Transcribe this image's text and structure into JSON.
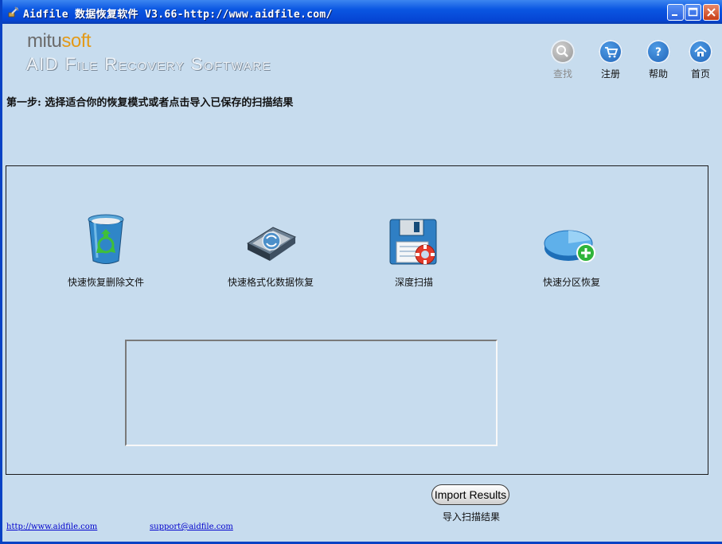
{
  "window": {
    "title": "Aidfile 数据恢复软件 V3.66-http://www.aidfile.com/",
    "buttons": [
      "minimize",
      "maximize",
      "close"
    ]
  },
  "logo": {
    "brand_prefix": "mitu",
    "brand_suffix": "soft",
    "subtitle": "AID File Recovery Software"
  },
  "topnav": [
    {
      "label": "查找",
      "icon": "magnifier-icon",
      "enabled": false
    },
    {
      "label": "注册",
      "icon": "cart-icon",
      "enabled": true
    },
    {
      "label": "帮助",
      "icon": "question-icon",
      "enabled": true
    },
    {
      "label": "首页",
      "icon": "home-icon",
      "enabled": true
    }
  ],
  "step_title": "第一步: 选择适合你的恢复模式或者点击导入已保存的扫描结果",
  "modes": [
    {
      "label": "快速恢复删除文件",
      "icon": "recycle-bin-icon"
    },
    {
      "label": "快速格式化数据恢复",
      "icon": "format-drive-icon"
    },
    {
      "label": "深度扫描",
      "icon": "floppy-lifebuoy-icon"
    },
    {
      "label": "快速分区恢复",
      "icon": "partition-plus-icon"
    }
  ],
  "import": {
    "button_label": "Import  Results",
    "caption": "导入扫描结果"
  },
  "links": {
    "website": "http://www.aidfile.com",
    "support": "support@aidfile.com"
  },
  "colors": {
    "titlebar": "#0a56e2",
    "client_bg": "#c7dcee",
    "nav_blue": "#1c5fb4",
    "link": "#0000cc"
  }
}
